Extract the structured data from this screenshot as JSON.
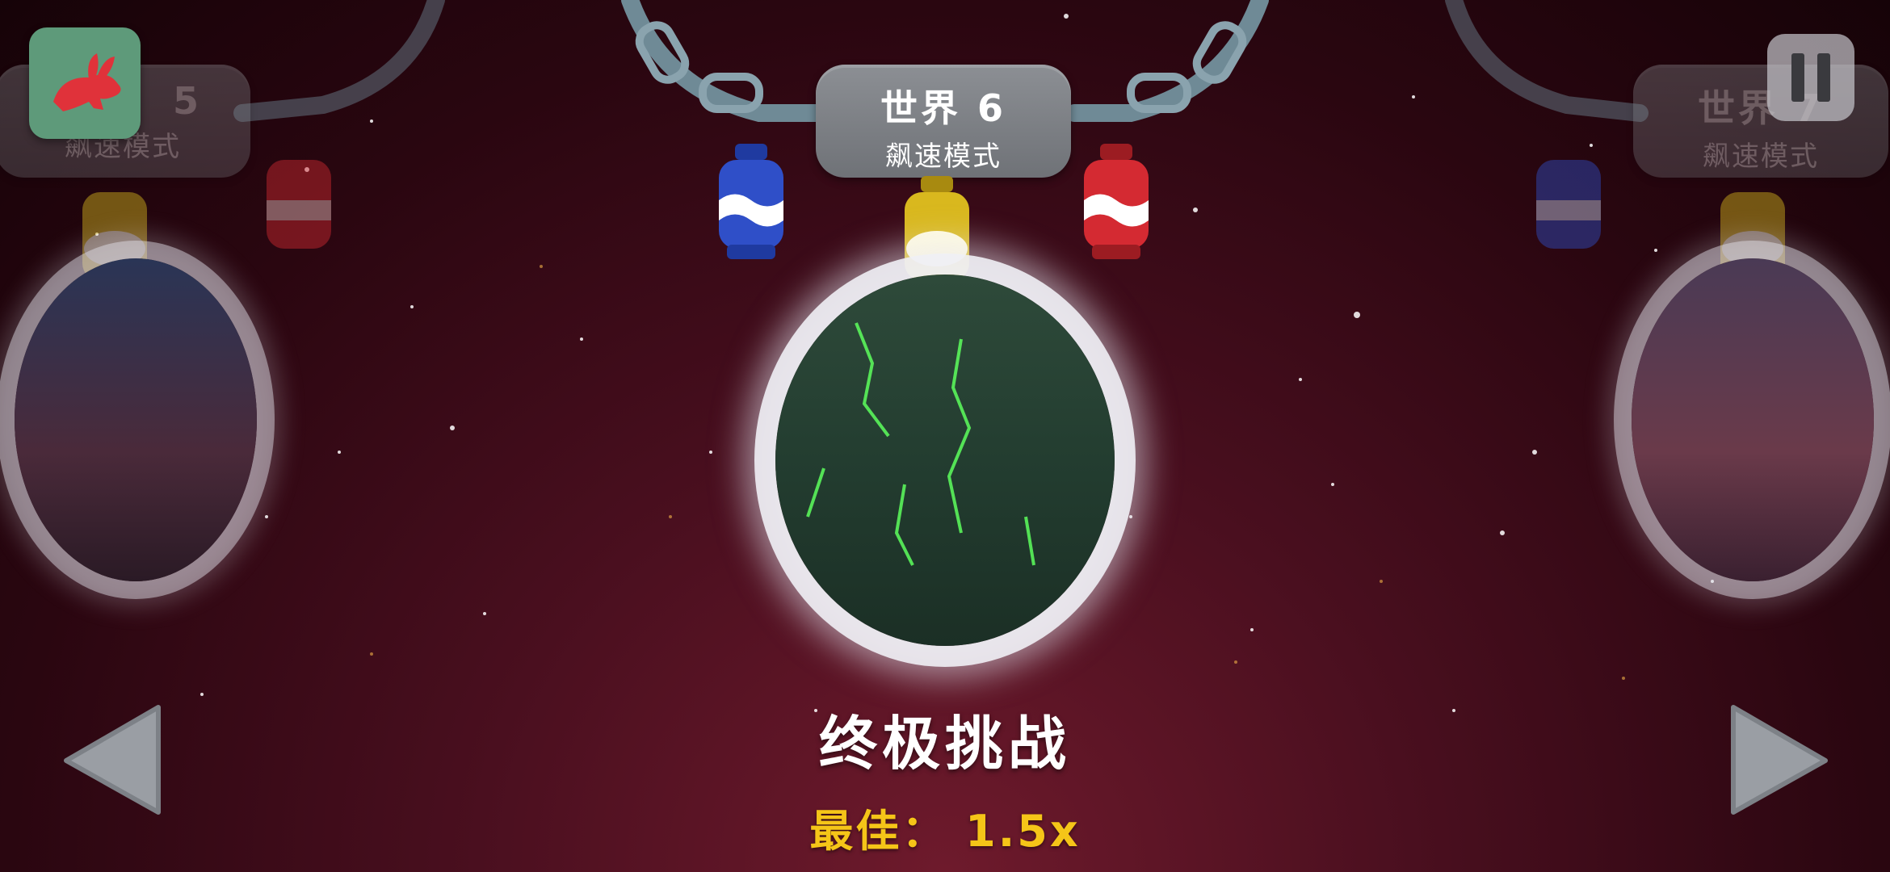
{
  "current_world": {
    "title": "世界 6",
    "mode": "飙速模式",
    "challenge": "终极挑战",
    "best_label": "最佳：",
    "best_value": "1.5x"
  },
  "prev_world": {
    "title": "5",
    "mode": "飙速模式"
  },
  "next_world": {
    "title": "世界",
    "number": "7",
    "mode": "飙速模式"
  },
  "buttons": {
    "speed_icon": "rabbit-icon",
    "pause_icon": "pause-icon",
    "prev_icon": "left-arrow-icon",
    "next_icon": "right-arrow-icon"
  },
  "colors": {
    "speed_button_bg": "#5e9a7a",
    "rabbit": "#e0323a",
    "best_text": "#f5c518",
    "lantern_blue": "#2f4fc8",
    "lantern_yellow": "#d9b81e",
    "lantern_red": "#d42a32"
  }
}
